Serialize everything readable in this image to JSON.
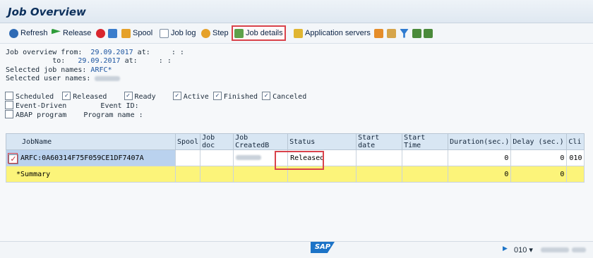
{
  "window": {
    "title": "Job Overview"
  },
  "toolbar": {
    "refresh": "Refresh",
    "release": "Release",
    "spool": "Spool",
    "job_log": "Job log",
    "step": "Step",
    "job_details": "Job details",
    "app_servers": "Application servers"
  },
  "criteria": {
    "from_label": "Job overview from:",
    "from_date": "29.09.2017",
    "at_label": "at:",
    "time_placeholder": ": :",
    "to_label": "to:",
    "to_date": "29.09.2017",
    "job_names_label": "Selected job names:",
    "job_names_value": "ARFC*",
    "user_names_label": "Selected user names:"
  },
  "filters": {
    "scheduled": "Scheduled",
    "released": "Released",
    "ready": "Ready",
    "active": "Active",
    "finished": "Finished",
    "canceled": "Canceled",
    "event_driven": "Event-Driven",
    "event_id_label": "Event ID:",
    "abap_program": "ABAP program",
    "program_name_label": "Program name :",
    "checked_mark": "✓"
  },
  "table": {
    "headers": [
      "JobName",
      "Spool",
      "Job doc",
      "Job CreatedB",
      "Status",
      "Start date",
      "Start Time",
      "Duration(sec.)",
      "Delay (sec.)",
      "Cli"
    ],
    "rows": [
      {
        "job_name": "ARFC:0A60314F75F059CE1DF7407A",
        "status": "Released",
        "duration": "0",
        "delay": "0",
        "client": "010"
      }
    ],
    "summary": {
      "label": "*Summary",
      "duration": "0",
      "delay": "0"
    }
  },
  "statusbar": {
    "logo": "SAP",
    "client": "010 ▾"
  },
  "colors": {
    "accent": "#1c73c7",
    "highlight": "#d9434b",
    "summary": "#fcf47a"
  }
}
